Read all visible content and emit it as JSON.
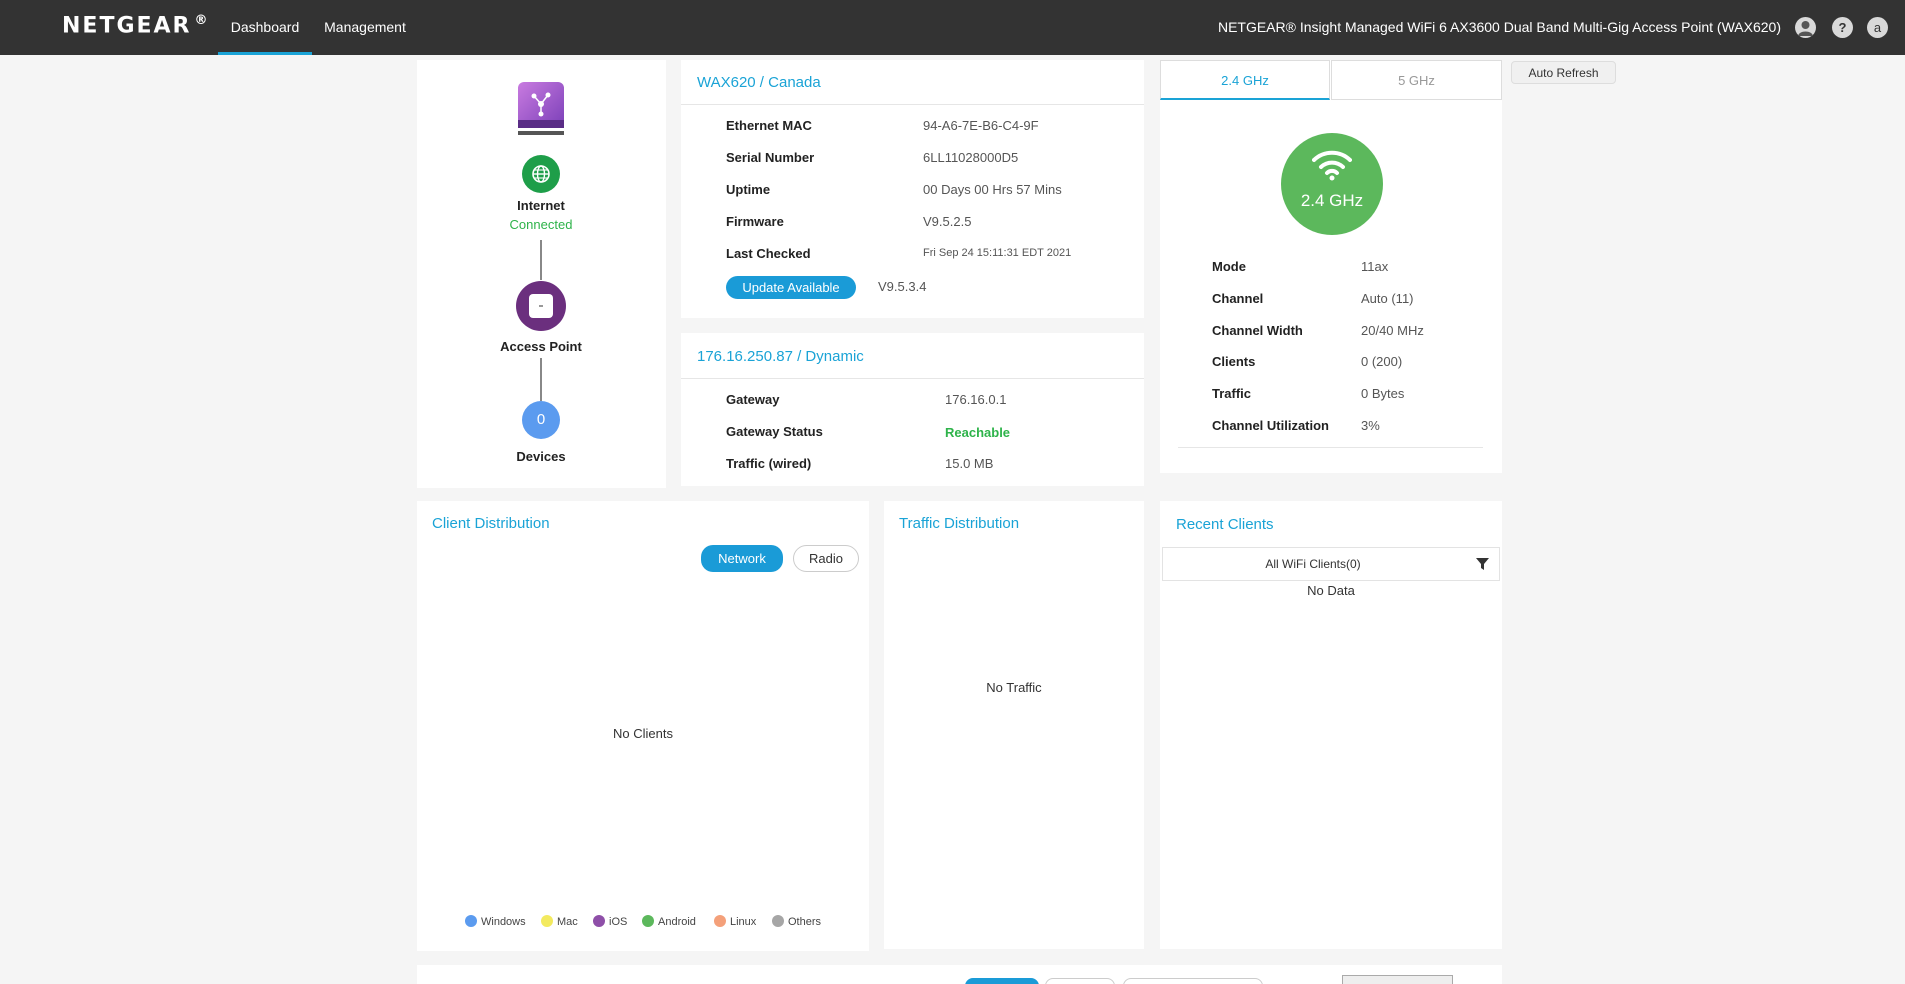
{
  "header": {
    "logo": "NETGEAR",
    "logo_mark": "®",
    "tabs": [
      {
        "label": "Dashboard",
        "active": true
      },
      {
        "label": "Management",
        "active": false
      }
    ],
    "device_title": "NETGEAR® Insight Managed WiFi 6 AX3600 Dual Band Multi-Gig Access Point (WAX620)",
    "icons": [
      "user-icon",
      "help-icon",
      "account-icon"
    ],
    "help_glyph": "?",
    "account_glyph": "a"
  },
  "topology": {
    "internet": {
      "label": "Internet",
      "status": "Connected"
    },
    "access_point": {
      "label": "Access Point"
    },
    "devices": {
      "label": "Devices",
      "count": "0"
    }
  },
  "device_info": {
    "title": "WAX620 / Canada",
    "rows": [
      {
        "label": "Ethernet MAC",
        "value": "94-A6-7E-B6-C4-9F"
      },
      {
        "label": "Serial Number",
        "value": "6LL11028000D5"
      },
      {
        "label": "Uptime",
        "value": "00 Days 00 Hrs 57 Mins"
      },
      {
        "label": "Firmware",
        "value": "V9.5.2.5"
      },
      {
        "label": "Last Checked",
        "value": "Fri Sep 24 15:11:31 EDT 2021"
      }
    ],
    "update_button": "Update Available",
    "update_version": "V9.5.3.4"
  },
  "ip_info": {
    "title": "176.16.250.87 / Dynamic",
    "rows": [
      {
        "label": "Gateway",
        "value": "176.16.0.1"
      },
      {
        "label": "Gateway Status",
        "value": "Reachable"
      },
      {
        "label": "Traffic (wired)",
        "value": "15.0 MB"
      }
    ]
  },
  "radio": {
    "tabs": [
      {
        "label": "2.4 GHz",
        "active": true
      },
      {
        "label": "5 GHz",
        "active": false
      }
    ],
    "badge": "2.4 GHz",
    "rows": [
      {
        "label": "Mode",
        "value": "11ax"
      },
      {
        "label": "Channel",
        "value": "Auto (11)"
      },
      {
        "label": "Channel Width",
        "value": "20/40 MHz"
      },
      {
        "label": "Clients",
        "value": "0 (200)"
      },
      {
        "label": "Traffic",
        "value": "0 Bytes"
      },
      {
        "label": "Channel Utilization",
        "value": "3%"
      }
    ],
    "auto_refresh": "Auto Refresh"
  },
  "client_distribution": {
    "title": "Client Distribution",
    "toggle": [
      "Network",
      "Radio"
    ],
    "empty": "No Clients",
    "legend": [
      {
        "label": "Windows",
        "color": "#5b9bef"
      },
      {
        "label": "Mac",
        "color": "#f3ea5f"
      },
      {
        "label": "iOS",
        "color": "#8e4fa8"
      },
      {
        "label": "Android",
        "color": "#5cb85c"
      },
      {
        "label": "Linux",
        "color": "#f4a07a"
      },
      {
        "label": "Others",
        "color": "#a6a6a6"
      }
    ]
  },
  "traffic_distribution": {
    "title": "Traffic Distribution",
    "empty": "No Traffic"
  },
  "recent_clients": {
    "title": "Recent Clients",
    "filter": "All WiFi Clients(0)",
    "empty": "No Data"
  },
  "colors": {
    "accent": "#1aa3d6",
    "topbar": "#333333",
    "connected": "#2eb34a",
    "radio_badge": "#5cb85c"
  }
}
